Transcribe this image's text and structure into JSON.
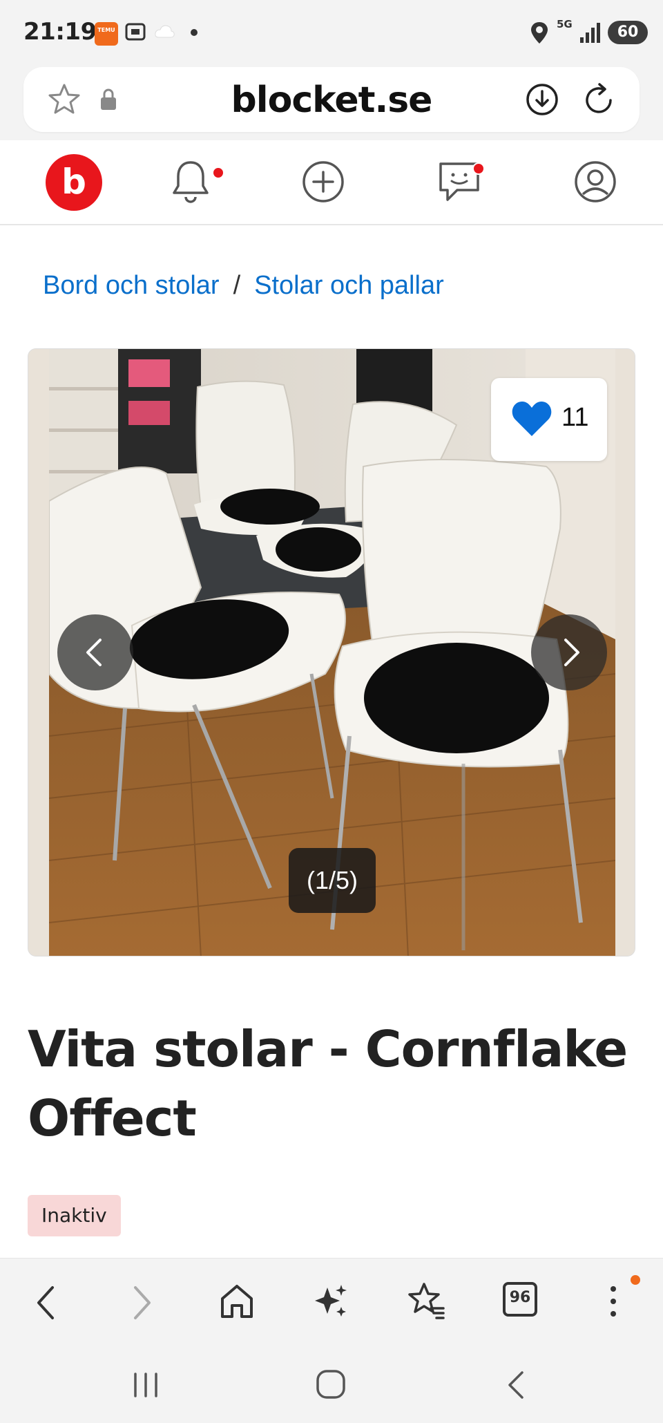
{
  "status_bar": {
    "time": "21:19",
    "temu_label": "TEMU",
    "network": "5G",
    "battery": "60"
  },
  "browser": {
    "url": "blocket.se"
  },
  "breadcrumb": {
    "items": [
      "Bord och stolar",
      "Stolar och pallar"
    ],
    "separator": "/"
  },
  "gallery": {
    "favorite_count": "11",
    "counter": "(1/5)"
  },
  "listing": {
    "title_line1": "Vita stolar - Cornflake",
    "title_line2": "Offect",
    "status": "Inaktiv"
  },
  "browser_nav": {
    "tabs_count": "96"
  },
  "colors": {
    "brand_red": "#e8161c",
    "link_blue": "#0a6fcb",
    "heart_blue": "#0a6fd9",
    "badge_bg": "#f8d7d7"
  }
}
